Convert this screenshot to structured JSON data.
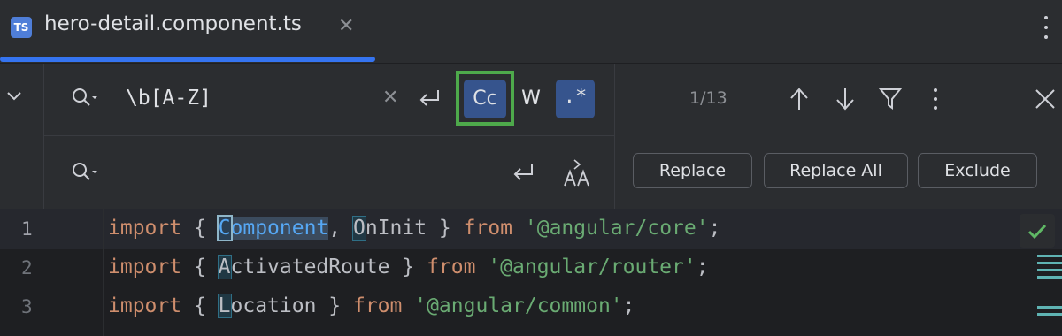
{
  "tab": {
    "icon_label": "TS",
    "title": "hero-detail.component.ts",
    "close_glyph": "✕"
  },
  "find": {
    "query": "\\b[A-Z]",
    "clear_glyph": "✕",
    "match_case_label": "Cc",
    "words_label": "W",
    "regex_label": ".*",
    "match_case_active": true,
    "regex_active": true,
    "match_count": "1/13"
  },
  "replace": {
    "value": "",
    "buttons": {
      "replace": "Replace",
      "replace_all": "Replace All",
      "exclude": "Exclude"
    }
  },
  "editor": {
    "lines": [
      {
        "number": "1"
      },
      {
        "number": "2"
      },
      {
        "number": "3"
      }
    ]
  },
  "colors": {
    "accent": "#3574f0",
    "highlight_toggle": "#36548d",
    "outline_green": "#4ea94b",
    "keyword": "#cf8e6d",
    "string": "#6aab73"
  }
}
